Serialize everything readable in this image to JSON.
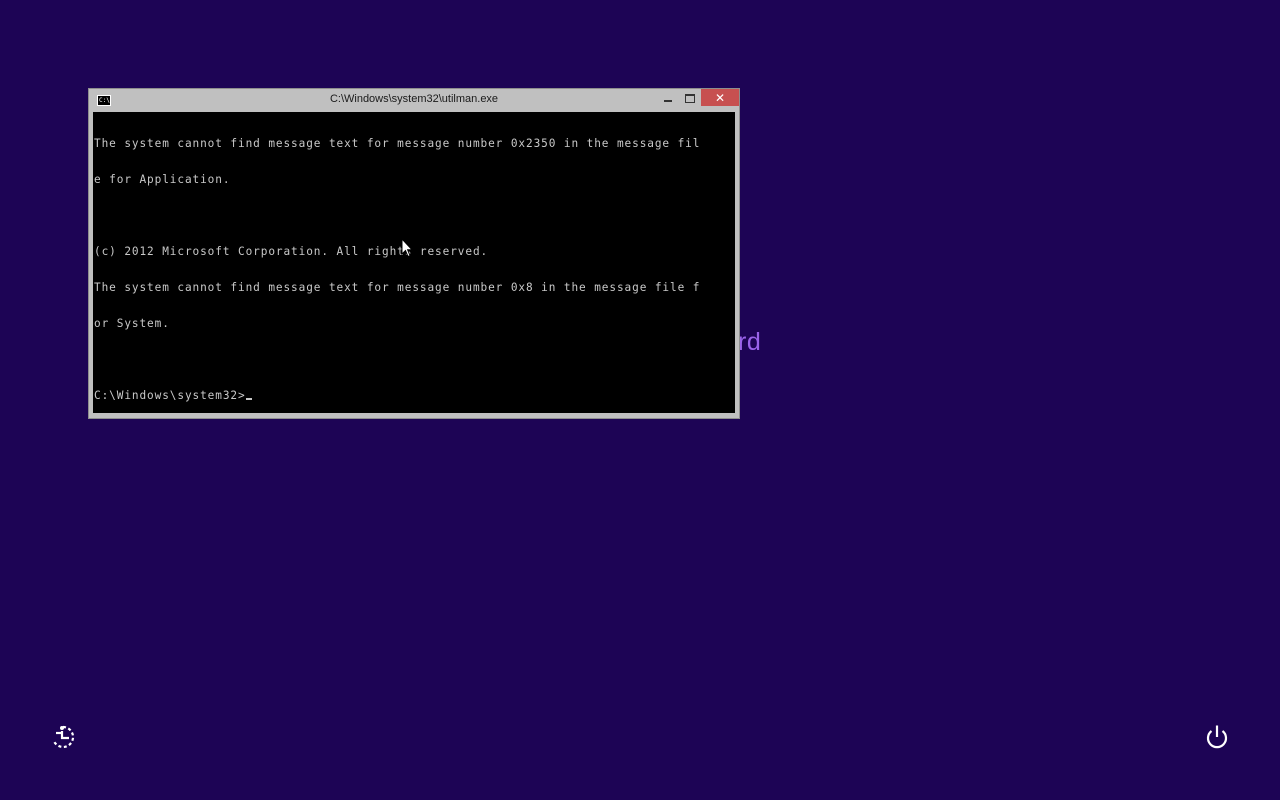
{
  "background": {
    "color": "#1d0455",
    "partial_text": "rd"
  },
  "window": {
    "title": "C:\\Windows\\system32\\utilman.exe",
    "icon": "cmd-icon",
    "icon_text": "C:\\",
    "minimize_label": "–",
    "maximize_label": "□",
    "close_label": "✕",
    "close_color": "#c75050"
  },
  "console": {
    "lines": [
      "The system cannot find message text for message number 0x2350 in the message fil",
      "e for Application.",
      "",
      "(c) 2012 Microsoft Corporation. All rights reserved.",
      "The system cannot find message text for message number 0x8 in the message file f",
      "or System.",
      "",
      "C:\\Windows\\system32>"
    ]
  },
  "bottom": {
    "ease_of_access_icon": "ease-of-access-icon",
    "power_icon": "power-icon"
  }
}
